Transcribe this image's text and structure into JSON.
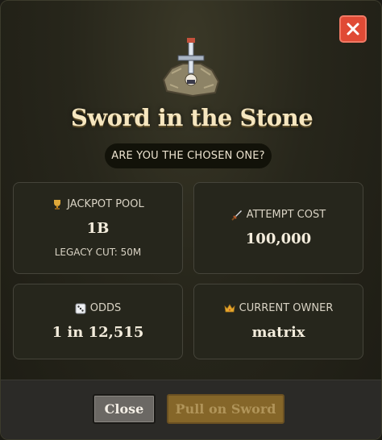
{
  "modal": {
    "title": "Sword in the Stone",
    "subtitle": "ARE YOU THE CHOSEN ONE?"
  },
  "stats": {
    "jackpot": {
      "icon": "trophy-icon",
      "label": "JACKPOT POOL",
      "value": "1B",
      "sub": "LEGACY CUT: 50M"
    },
    "attempt": {
      "icon": "dagger-icon",
      "label": "ATTEMPT COST",
      "value": "100,000"
    },
    "odds": {
      "icon": "dice-icon",
      "label": "ODDS",
      "value": "1 in 12,515"
    },
    "owner": {
      "icon": "crown-icon",
      "label": "CURRENT OWNER",
      "value": "matrix"
    }
  },
  "buttons": {
    "close_label": "Close",
    "pull_label": "Pull on Sword"
  },
  "colors": {
    "close_x": "#e04a35",
    "pull_button": "#8a6a2a",
    "title": "#f6e6bf"
  }
}
